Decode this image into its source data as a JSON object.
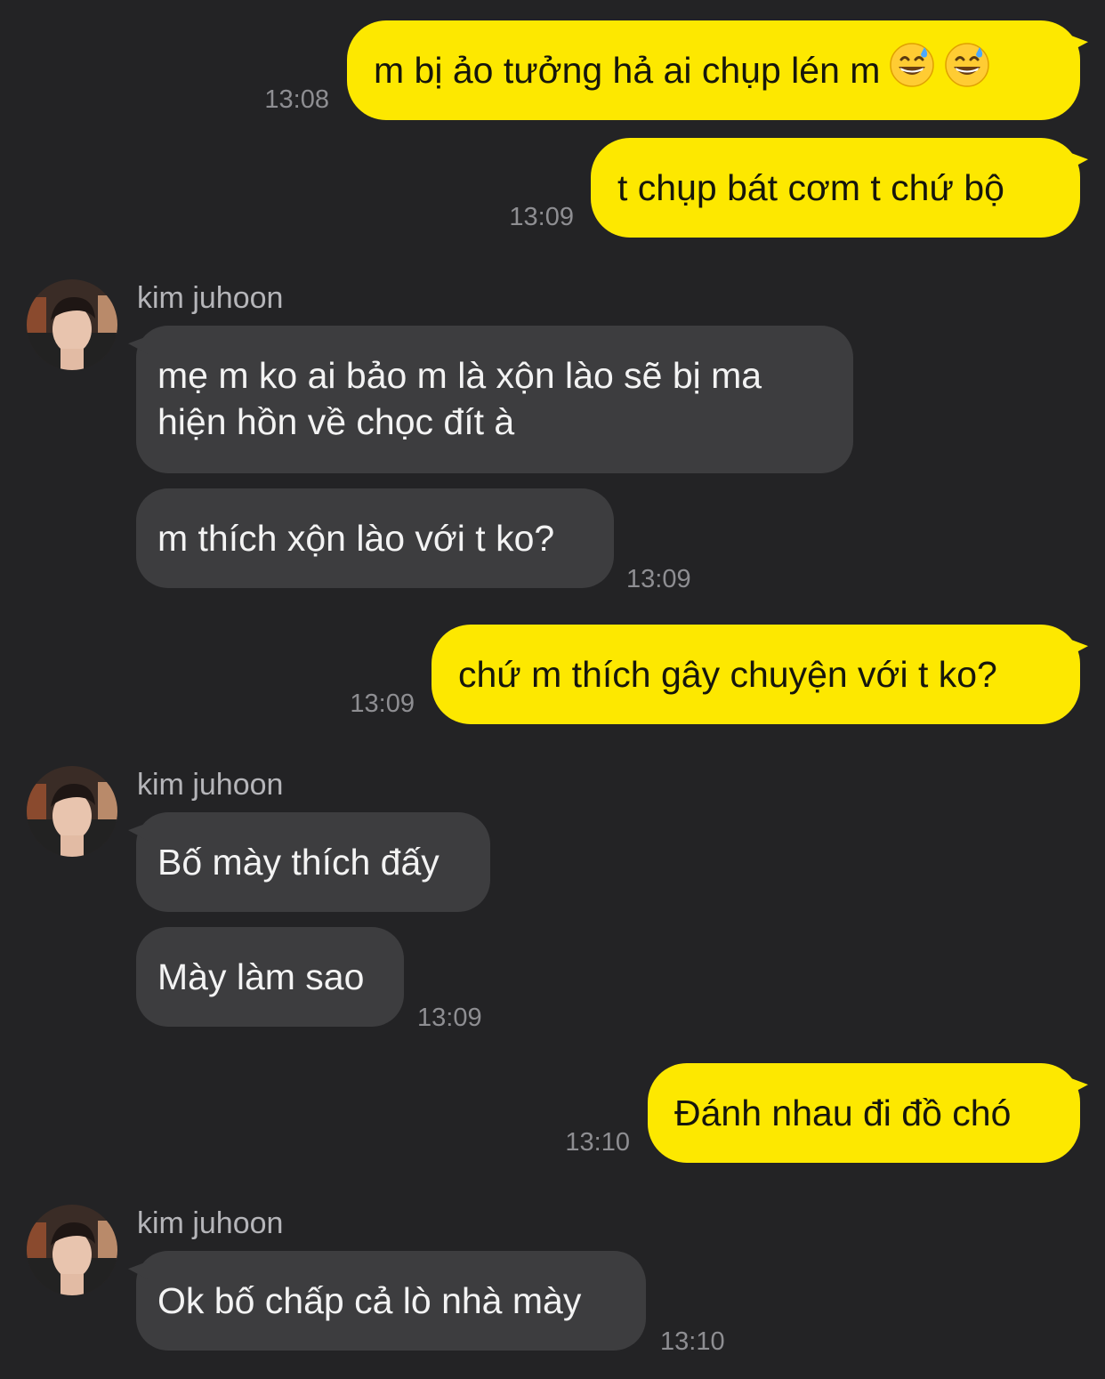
{
  "colors": {
    "background": "#232325",
    "my_bubble": "#fde800",
    "their_bubble": "#3d3d3f",
    "timestamp": "#8e8e92",
    "sender_name": "#b5b5b9"
  },
  "messages": [
    {
      "from": "me",
      "text": "m bị ảo tưởng hả ai chụp lén m",
      "emoji": [
        "grinning-sweat-emoji",
        "grinning-sweat-emoji"
      ],
      "time": "13:08"
    },
    {
      "from": "me",
      "text": "t chụp bát cơm t chứ bộ",
      "time": "13:09"
    },
    {
      "from": "kim juhoon",
      "sender": "kim juhoon",
      "text": "mẹ m ko ai bảo m là xộn lào sẽ bị ma hiện hồn về chọc đít à"
    },
    {
      "from": "kim juhoon",
      "text": "m thích xộn lào với t ko?",
      "time": "13:09"
    },
    {
      "from": "me",
      "text": "chứ m thích gây chuyện với t ko?",
      "time": "13:09"
    },
    {
      "from": "kim juhoon",
      "sender": "kim juhoon",
      "text": "Bố mày thích đấy"
    },
    {
      "from": "kim juhoon",
      "text": "Mày làm sao",
      "time": "13:09"
    },
    {
      "from": "me",
      "text": "Đánh nhau đi đồ chó",
      "time": "13:10"
    },
    {
      "from": "kim juhoon",
      "sender": "kim juhoon",
      "text": "Ok bố chấp cả lò nhà mày",
      "time": "13:10"
    }
  ]
}
